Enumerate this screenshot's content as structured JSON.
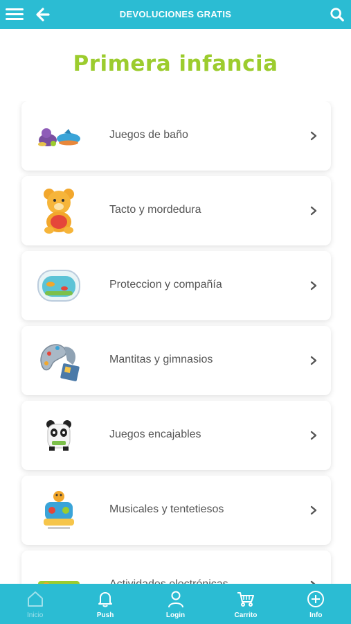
{
  "header": {
    "title": "DEVOLUCIONES GRATIS",
    "menu_icon": "hamburger-icon",
    "back_icon": "back-arrow-icon",
    "search_icon": "search-icon",
    "bg_color": "#2bbcd3"
  },
  "page": {
    "heading": "Primera infancia",
    "heading_color": "#9ccc2e"
  },
  "categories": [
    {
      "label": "Juegos de baño",
      "icon": "bath-toys-icon"
    },
    {
      "label": "Tacto y mordedura",
      "icon": "teddy-bear-icon"
    },
    {
      "label": "Proteccion y compañía",
      "icon": "crib-aquarium-icon"
    },
    {
      "label": "Mantitas y gimnasios",
      "icon": "play-mat-icon"
    },
    {
      "label": "Juegos encajables",
      "icon": "panda-toy-icon"
    },
    {
      "label": "Musicales y tentetiesos",
      "icon": "musical-toy-icon"
    },
    {
      "label": "Actividades electrónicas",
      "icon": "electronic-activity-icon"
    }
  ],
  "tabbar": {
    "items": [
      {
        "label": "Inicio",
        "icon": "home-icon",
        "active": true
      },
      {
        "label": "Push",
        "icon": "bell-icon",
        "active": false
      },
      {
        "label": "Login",
        "icon": "user-icon",
        "active": false
      },
      {
        "label": "Carrito",
        "icon": "cart-icon",
        "active": false
      },
      {
        "label": "Info",
        "icon": "plus-circle-icon",
        "active": false
      }
    ]
  }
}
